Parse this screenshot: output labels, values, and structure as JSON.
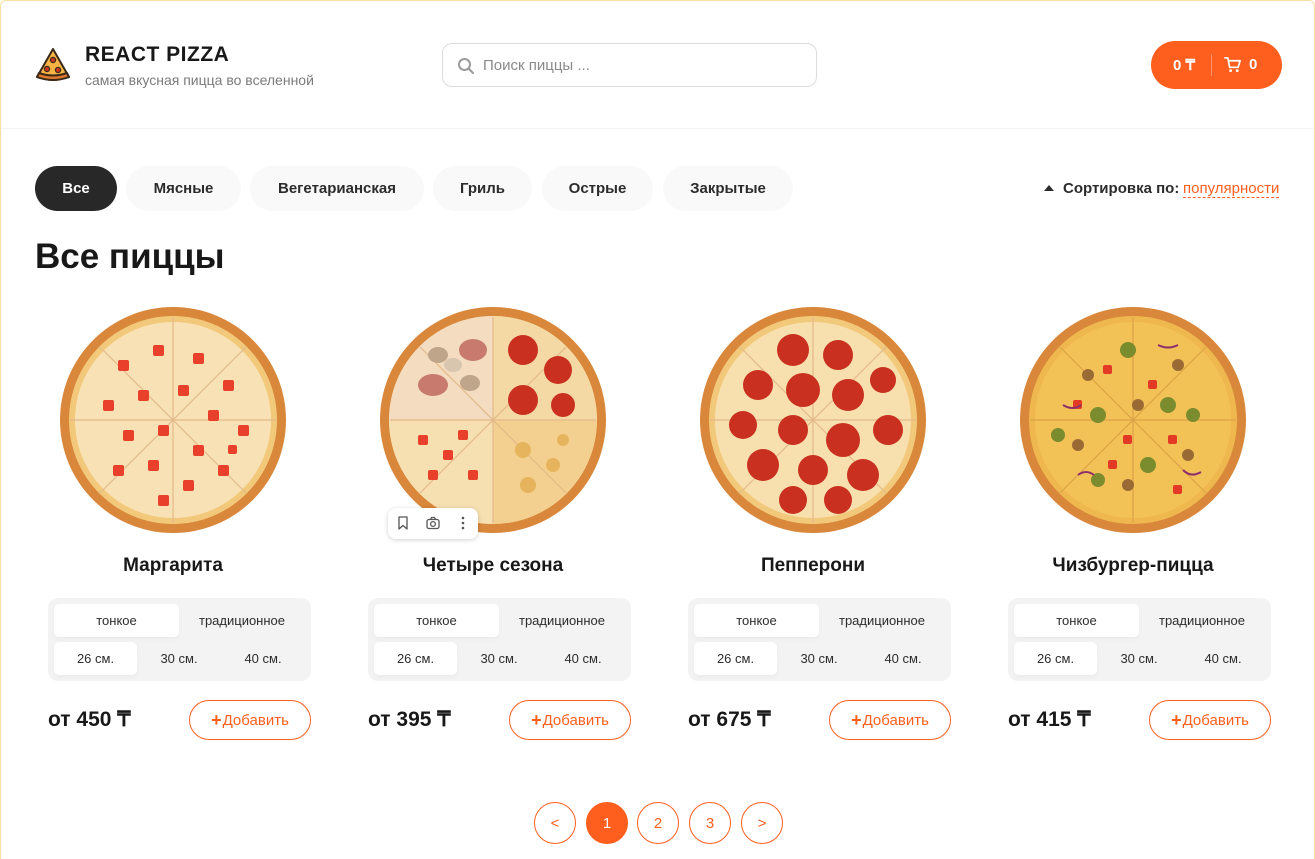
{
  "header": {
    "title": "REACT PIZZA",
    "subtitle": "самая вкусная пицца во вселенной",
    "search_placeholder": "Поиск пиццы ...",
    "cart_price": "0 ₸",
    "cart_count": "0"
  },
  "categories": [
    "Все",
    "Мясные",
    "Вегетарианская",
    "Гриль",
    "Острые",
    "Закрытые"
  ],
  "active_category": "Все",
  "sort": {
    "label": "Сортировка по:",
    "value": "популярности"
  },
  "page_title": "Все пиццы",
  "pizzas": [
    {
      "name": "Маргарита",
      "price": "от 450 ₸",
      "types": [
        "тонкое",
        "традиционное"
      ],
      "sizes": [
        "26 см.",
        "30 см.",
        "40 см."
      ],
      "topping": "tomato"
    },
    {
      "name": "Четыре сезона",
      "price": "от 395 ₸",
      "types": [
        "тонкое",
        "традиционное"
      ],
      "sizes": [
        "26 см.",
        "30 см.",
        "40 см."
      ],
      "topping": "four-seasons"
    },
    {
      "name": "Пепперони",
      "price": "от 675 ₸",
      "types": [
        "тонкое",
        "традиционное"
      ],
      "sizes": [
        "26 см.",
        "30 см.",
        "40 см."
      ],
      "topping": "pepperoni"
    },
    {
      "name": "Чизбургер-пицца",
      "price": "от 415 ₸",
      "types": [
        "тонкое",
        "традиционное"
      ],
      "sizes": [
        "26 см.",
        "30 см.",
        "40 см."
      ],
      "topping": "cheeseburger"
    }
  ],
  "add_label": "Добавить",
  "pagination": {
    "prev": "<",
    "pages": [
      "1",
      "2",
      "3"
    ],
    "current": "1",
    "next": ">"
  },
  "colors": {
    "accent": "#fe5f1e",
    "dark": "#282828",
    "pill_bg": "#f9f9f9",
    "selector_bg": "#f3f3f3"
  }
}
